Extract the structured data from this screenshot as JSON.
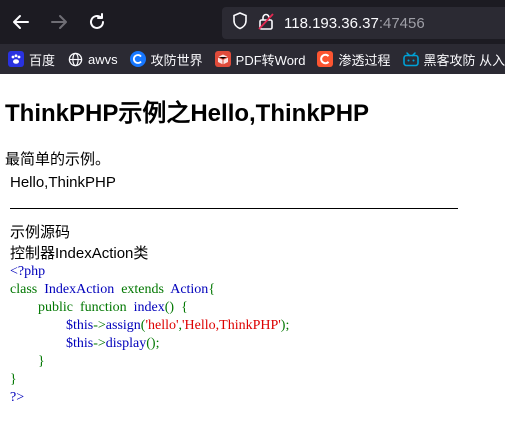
{
  "browser": {
    "url_host": "118.193.36.37",
    "url_port": ":47456",
    "bookmarks": [
      {
        "label": "百度",
        "icon": "baidu-paw-icon",
        "color": "#2932e1"
      },
      {
        "label": "awvs",
        "icon": "globe-icon",
        "color": "#fbfbfe"
      },
      {
        "label": "攻防世界",
        "icon": "adworld-icon",
        "color": "#1677ff"
      },
      {
        "label": "PDF转Word",
        "icon": "pdf-box-icon",
        "color": "#e04b3a"
      },
      {
        "label": "渗透过程",
        "icon": "csdn-c-icon",
        "color": "#fc5531"
      },
      {
        "label": "黑客攻防 从入门到",
        "icon": "bilibili-tv-icon",
        "color": "#00a1d6"
      }
    ]
  },
  "page": {
    "title": "ThinkPHP示例之Hello,ThinkPHP",
    "intro": "最简单的示例。",
    "hello": "Hello,ThinkPHP",
    "source_title": "示例源码",
    "controller_title": "控制器IndexAction类"
  },
  "code": {
    "open_tag": "<?php",
    "kw_class": "class",
    "class_name": "IndexAction",
    "kw_extends": "extends",
    "parent": "Action",
    "brace_open": "{",
    "kw_public": "public",
    "kw_function": "function",
    "fn_name": "index",
    "fn_parens": "()",
    "fn_brace": "{",
    "var_this": "$this",
    "arrow": "->",
    "m_assign": "assign",
    "paren_open": "(",
    "str_hello": "'hello'",
    "comma": ",",
    "str_value": "'Hello,ThinkPHP'",
    "paren_close_semi": ");",
    "m_display": "display",
    "call_empty": "();",
    "fn_brace_close": "}",
    "brace_close": "}",
    "close_tag": "?>"
  },
  "colors": {
    "chrome_dark": "#1c1b22",
    "bookmark_bar": "#2b2a33",
    "code_blue": "#0000bb",
    "code_green": "#007700",
    "code_red": "#dd0000"
  }
}
